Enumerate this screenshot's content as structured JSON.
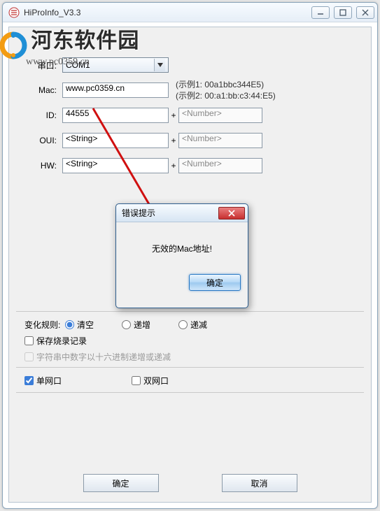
{
  "window": {
    "title": "HiProInfo_V3.3"
  },
  "watermark": {
    "brand": "河东软件园",
    "url": "www.pc0359.cn"
  },
  "form": {
    "serial": {
      "label": "串口:",
      "value": "COM1"
    },
    "mac": {
      "label": "Mac:",
      "value": "www.pc0359.cn",
      "hint1": "(示例1: 00a1bbc344E5)",
      "hint2": "(示例2: 00:a1:bb:c3:44:E5)"
    },
    "id": {
      "label": "ID:",
      "value": "44555",
      "plus": "+",
      "placeholder": "<Number>"
    },
    "oui": {
      "label": "OUI:",
      "value": "<String>",
      "plus": "+",
      "placeholder": "<Number>"
    },
    "hw": {
      "label": "HW:",
      "value": "<String>",
      "plus": "+",
      "placeholder": "<Number>"
    }
  },
  "rules": {
    "label": "变化规则:",
    "options": {
      "clear": "清空",
      "inc": "递增",
      "dec": "递减"
    },
    "selected": "clear"
  },
  "checks": {
    "save_log": "保存烧录记录",
    "hex_mode": "字符串中数字以十六进制递增或递减"
  },
  "net": {
    "single": "单网口",
    "dual": "双网口"
  },
  "buttons": {
    "ok": "确定",
    "cancel": "取消"
  },
  "dialog": {
    "title": "错误提示",
    "message": "无效的Mac地址!",
    "ok": "确定"
  }
}
